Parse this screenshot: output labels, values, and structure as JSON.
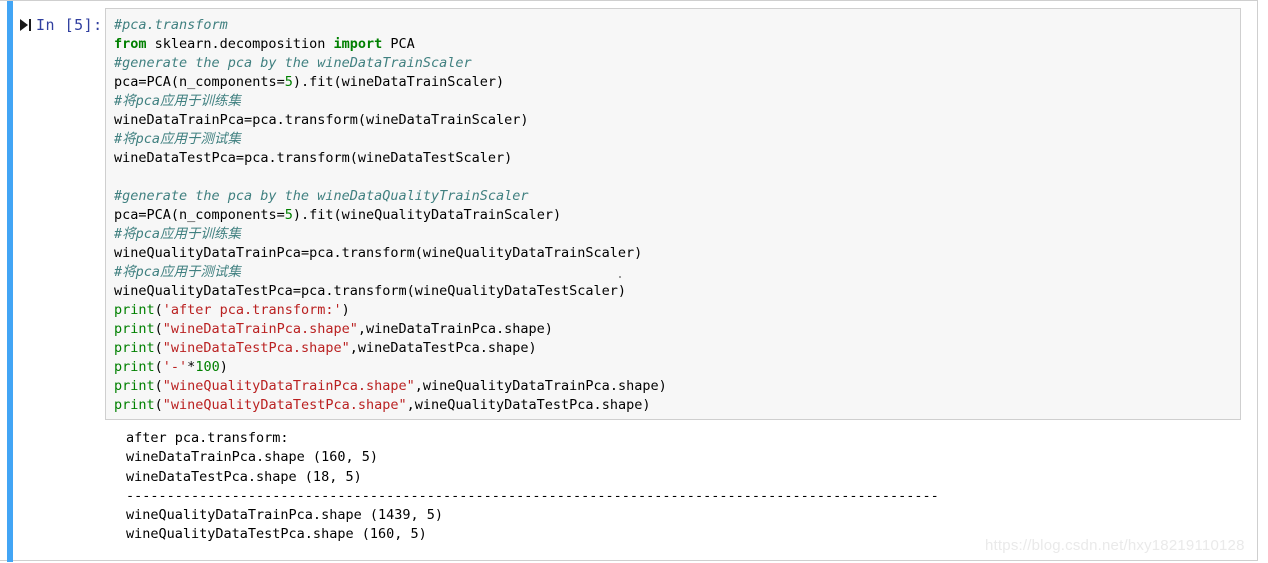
{
  "notebook": {
    "prompt": {
      "label": "In  [5]:",
      "execution_count": "5",
      "run_icon": "run-cell-icon"
    },
    "selection_bar_color": "#42a5f5",
    "prompt_color": "#303f9f",
    "cell_background": "#f7f7f7",
    "cell_border_color": "#cfcfcf"
  },
  "syntax_colors": {
    "comment": "#408080",
    "keyword": "#008000",
    "builtin": "#008000",
    "string": "#ba2121",
    "number": "#008000",
    "operator": "#aa22ff",
    "plain": "#000000"
  },
  "code_cell": {
    "language": "python",
    "lines": [
      [
        {
          "t": "#pca.transform",
          "c": "comment"
        }
      ],
      [
        {
          "t": "from",
          "c": "keyword"
        },
        {
          "t": " sklearn.decomposition ",
          "c": "plain"
        },
        {
          "t": "import",
          "c": "keyword"
        },
        {
          "t": " PCA",
          "c": "plain"
        }
      ],
      [
        {
          "t": "#generate the pca by the wineDataTrainScaler",
          "c": "comment"
        }
      ],
      [
        {
          "t": "pca",
          "c": "plain"
        },
        {
          "t": "=",
          "c": "operator"
        },
        {
          "t": "PCA(n_components",
          "c": "plain"
        },
        {
          "t": "=",
          "c": "operator"
        },
        {
          "t": "5",
          "c": "number"
        },
        {
          "t": ").fit(wineDataTrainScaler)",
          "c": "plain"
        }
      ],
      [
        {
          "t": "#将pca应用于训练集",
          "c": "comment"
        }
      ],
      [
        {
          "t": "wineDataTrainPca",
          "c": "plain"
        },
        {
          "t": "=",
          "c": "operator"
        },
        {
          "t": "pca.transform(wineDataTrainScaler)",
          "c": "plain"
        }
      ],
      [
        {
          "t": "#将pca应用于测试集",
          "c": "comment"
        }
      ],
      [
        {
          "t": "wineDataTestPca",
          "c": "plain"
        },
        {
          "t": "=",
          "c": "operator"
        },
        {
          "t": "pca.transform(wineDataTestScaler)",
          "c": "plain"
        }
      ],
      [
        {
          "t": "",
          "c": "plain"
        }
      ],
      [
        {
          "t": "#generate the pca by the wineDataQualityTrainScaler",
          "c": "comment"
        }
      ],
      [
        {
          "t": "pca",
          "c": "plain"
        },
        {
          "t": "=",
          "c": "operator"
        },
        {
          "t": "PCA(n_components",
          "c": "plain"
        },
        {
          "t": "=",
          "c": "operator"
        },
        {
          "t": "5",
          "c": "number"
        },
        {
          "t": ").fit(wineQualityDataTrainScaler)",
          "c": "plain"
        }
      ],
      [
        {
          "t": "#将pca应用于训练集",
          "c": "comment"
        }
      ],
      [
        {
          "t": "wineQualityDataTrainPca",
          "c": "plain"
        },
        {
          "t": "=",
          "c": "operator"
        },
        {
          "t": "pca.transform(wineQualityDataTrainScaler)",
          "c": "plain"
        }
      ],
      [
        {
          "t": "#将pca应用于测试集",
          "c": "comment"
        }
      ],
      [
        {
          "t": "wineQualityDataTestPca",
          "c": "plain"
        },
        {
          "t": "=",
          "c": "operator"
        },
        {
          "t": "pca.transform(wineQualityDataTestScaler)",
          "c": "plain"
        }
      ],
      [
        {
          "t": "print",
          "c": "builtin"
        },
        {
          "t": "(",
          "c": "plain"
        },
        {
          "t": "'after pca.transform:'",
          "c": "string"
        },
        {
          "t": ")",
          "c": "plain"
        }
      ],
      [
        {
          "t": "print",
          "c": "builtin"
        },
        {
          "t": "(",
          "c": "plain"
        },
        {
          "t": "\"wineDataTrainPca.shape\"",
          "c": "string"
        },
        {
          "t": ",wineDataTrainPca.shape)",
          "c": "plain"
        }
      ],
      [
        {
          "t": "print",
          "c": "builtin"
        },
        {
          "t": "(",
          "c": "plain"
        },
        {
          "t": "\"wineDataTestPca.shape\"",
          "c": "string"
        },
        {
          "t": ",wineDataTestPca.shape)",
          "c": "plain"
        }
      ],
      [
        {
          "t": "print",
          "c": "builtin"
        },
        {
          "t": "(",
          "c": "plain"
        },
        {
          "t": "'-'",
          "c": "string"
        },
        {
          "t": "*",
          "c": "operator"
        },
        {
          "t": "100",
          "c": "number"
        },
        {
          "t": ")",
          "c": "plain"
        }
      ],
      [
        {
          "t": "print",
          "c": "builtin"
        },
        {
          "t": "(",
          "c": "plain"
        },
        {
          "t": "\"wineQualityDataTrainPca.shape\"",
          "c": "string"
        },
        {
          "t": ",wineQualityDataTrainPca.shape)",
          "c": "plain"
        }
      ],
      [
        {
          "t": "print",
          "c": "builtin"
        },
        {
          "t": "(",
          "c": "plain"
        },
        {
          "t": "\"wineQualityDataTestPca.shape\"",
          "c": "string"
        },
        {
          "t": ",wineQualityDataTestPca.shape)",
          "c": "plain"
        }
      ]
    ]
  },
  "output": {
    "lines": [
      "after pca.transform:",
      "wineDataTrainPca.shape (160, 5)",
      "wineDataTestPca.shape (18, 5)",
      "----------------------------------------------------------------------------------------------------",
      "wineQualityDataTrainPca.shape (1439, 5)",
      "wineQualityDataTestPca.shape (160, 5)"
    ],
    "shapes": {
      "wineDataTrainPca": "(160, 5)",
      "wineDataTestPca": "(18, 5)",
      "wineQualityDataTrainPca": "(1439, 5)",
      "wineQualityDataTestPca": "(160, 5)"
    }
  },
  "watermark": {
    "text": "https://blog.csdn.net/hxy18219110128"
  }
}
